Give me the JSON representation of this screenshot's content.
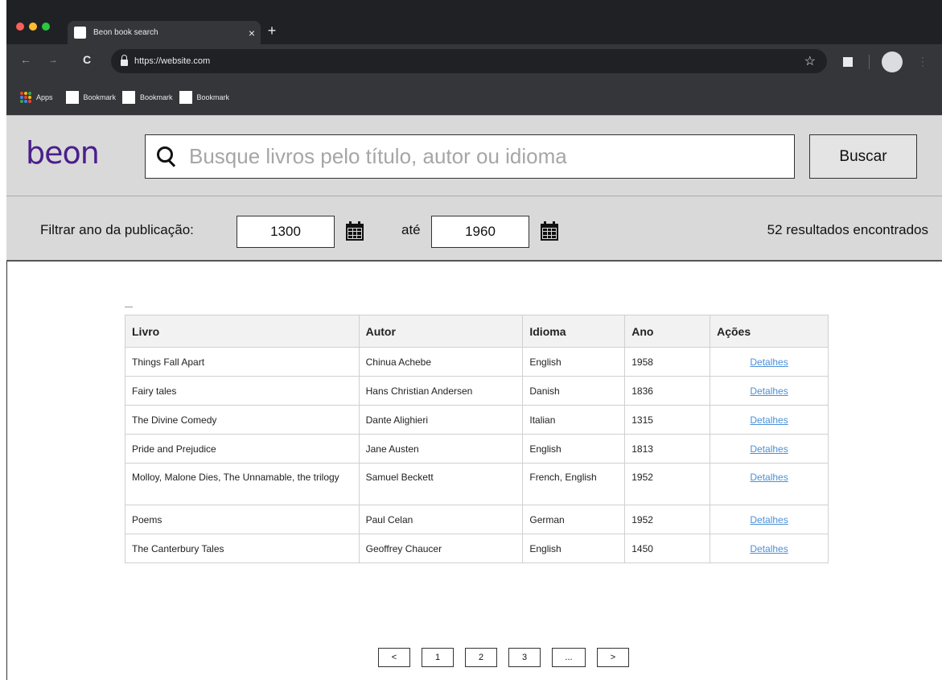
{
  "browser": {
    "tab_title": "Beon book search",
    "tab_close": "×",
    "new_tab": "+",
    "url": "https://website.com",
    "back": "←",
    "forward": "→",
    "reload": "C",
    "star": "☆",
    "menu": "⋮",
    "traffic_colors": [
      "#ff5f57",
      "#febc2e",
      "#28c840"
    ],
    "bookmarks": {
      "apps_label": "Apps",
      "items": [
        "Bookmark",
        "Bookmark",
        "Bookmark"
      ]
    }
  },
  "header": {
    "logo": "beon",
    "logo_color": "#4a1f8a",
    "search_placeholder": "Busque livros pelo título, autor ou idioma",
    "search_button": "Buscar"
  },
  "filter": {
    "label": "Filtrar ano da publicação:",
    "from_year": "1300",
    "to_label": "até",
    "to_year": "1960",
    "result_count": "52 resultados encontrados"
  },
  "table": {
    "columns": [
      "Livro",
      "Autor",
      "Idioma",
      "Ano",
      "Ações"
    ],
    "rows": [
      {
        "livro": "Things Fall Apart",
        "autor": "Chinua Achebe",
        "idioma": "English",
        "ano": "1958",
        "acao": "Detalhes"
      },
      {
        "livro": "Fairy tales",
        "autor": "Hans Christian Andersen",
        "idioma": "Danish",
        "ano": "1836",
        "acao": "Detalhes"
      },
      {
        "livro": "The Divine Comedy",
        "autor": "Dante Alighieri",
        "idioma": "Italian",
        "ano": "1315",
        "acao": "Detalhes"
      },
      {
        "livro": "Pride and Prejudice",
        "autor": "Jane Austen",
        "idioma": "English",
        "ano": "1813",
        "acao": "Detalhes"
      },
      {
        "livro": "Molloy, Malone Dies, The Unnamable, the trilogy",
        "autor": "Samuel Beckett",
        "idioma": "French, English",
        "ano": "1952",
        "acao": "Detalhes"
      },
      {
        "livro": "Poems",
        "autor": "Paul Celan",
        "idioma": "German",
        "ano": "1952",
        "acao": "Detalhes"
      },
      {
        "livro": "The Canterbury Tales",
        "autor": "Geoffrey Chaucer",
        "idioma": "English",
        "ano": "1450",
        "acao": "Detalhes"
      }
    ]
  },
  "pagination": {
    "prev": "<",
    "pages": [
      "1",
      "2",
      "3"
    ],
    "ellipsis": "...",
    "next": ">"
  }
}
